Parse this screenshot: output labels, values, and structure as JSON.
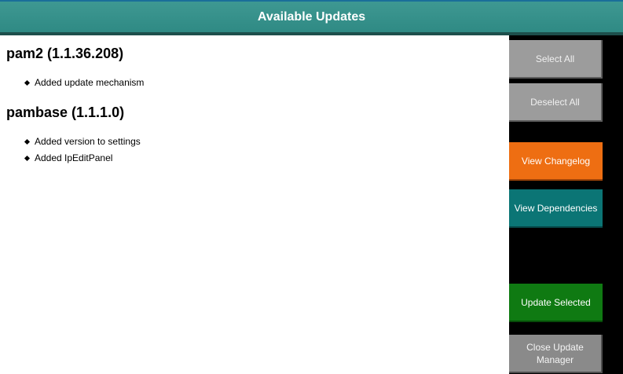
{
  "window": {
    "title": "Available Updates"
  },
  "packages": [
    {
      "title": "pam2 (1.1.36.208)",
      "changes": [
        "Added update mechanism"
      ]
    },
    {
      "title": "pambase (1.1.1.0)",
      "changes": [
        "Added version to settings",
        "Added IpEditPanel"
      ]
    }
  ],
  "buttons": {
    "select_all": "Select All",
    "deselect_all": "Deselect All",
    "view_changelog": "View Changelog",
    "view_dependencies": "View Dependencies",
    "update_selected": "Update Selected",
    "close_line1": "Close Update",
    "close_line2": "Manager"
  },
  "colors": {
    "title_bar": "#3a948e",
    "changelog_button": "#ee6e12",
    "dependencies_button": "#0b7575",
    "update_button": "#0f7a12",
    "neutral_button": "#9c9c9c"
  }
}
